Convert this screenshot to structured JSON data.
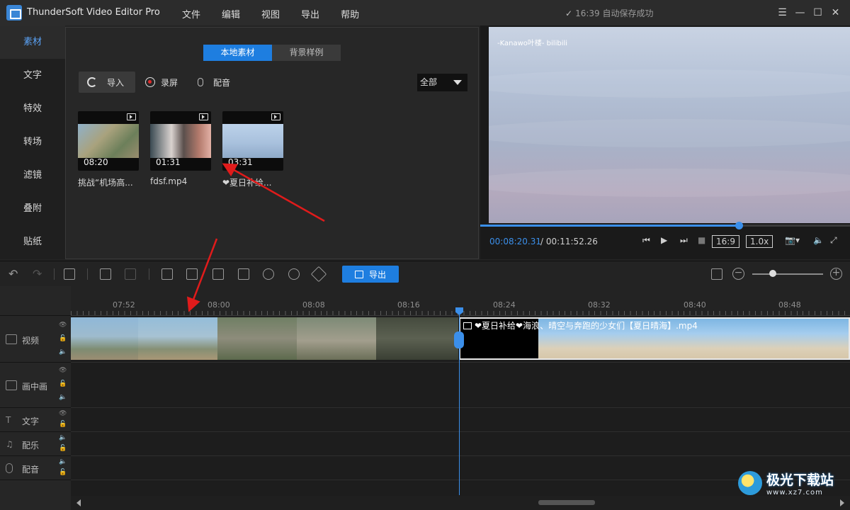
{
  "app": {
    "title": "ThunderSoft Video Editor Pro",
    "menu": [
      "文件",
      "编辑",
      "视图",
      "导出",
      "帮助"
    ],
    "save_status": "16:39 自动保存成功",
    "accent": "#1e7ee0"
  },
  "sidebar": {
    "items": [
      {
        "label": "素材",
        "active": true
      },
      {
        "label": "文字"
      },
      {
        "label": "特效"
      },
      {
        "label": "转场"
      },
      {
        "label": "滤镜"
      },
      {
        "label": "叠附"
      },
      {
        "label": "贴纸"
      }
    ]
  },
  "media": {
    "tabs": [
      {
        "label": "本地素材",
        "active": true
      },
      {
        "label": "背景样例"
      }
    ],
    "import_label": "导入",
    "record_label": "录屏",
    "voice_label": "配音",
    "filter_value": "全部",
    "clips": [
      {
        "duration": "08:20",
        "name": "挑战“机场高..."
      },
      {
        "duration": "01:31",
        "name": "fdsf.mp4"
      },
      {
        "duration": "03:31",
        "name": "❤夏日补给..."
      }
    ]
  },
  "preview": {
    "watermark": "-Kanawo叶楼- bilibili",
    "current_time": "00:08:20.31",
    "separator": "/",
    "total_time": "00:11:52.26",
    "progress_fraction": 0.7,
    "aspect_ratio": "16:9",
    "speed": "1.0x"
  },
  "toolbar": {
    "export_label": "导出"
  },
  "timeline": {
    "ruler_labels": [
      "07:52",
      "08:00",
      "08:08",
      "08:16",
      "08:24",
      "08:32",
      "08:40",
      "08:48"
    ],
    "tracks": [
      {
        "label": "视频"
      },
      {
        "label": "画中画"
      },
      {
        "label": "文字"
      },
      {
        "label": "配乐"
      },
      {
        "label": "配音"
      }
    ],
    "clip_b_title": "❤夏日补给❤海浪、晴空与奔跑的少女们【夏日晴海】.mp4"
  },
  "badge": {
    "name": "极光下载站",
    "url": "www.xz7.com"
  }
}
